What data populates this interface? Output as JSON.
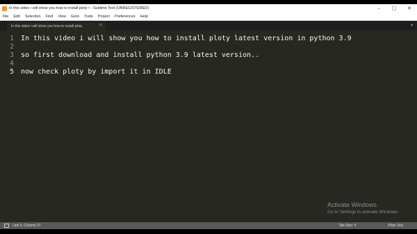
{
  "window": {
    "title": "In this video i will show you how to install ploty • - Sublime Text (UNREGISTERED)",
    "controls": [
      "–",
      "▢",
      "✕"
    ]
  },
  "menu": [
    "File",
    "Edit",
    "Selection",
    "Find",
    "View",
    "Goto",
    "Tools",
    "Project",
    "Preferences",
    "Help"
  ],
  "tab": {
    "label": "In this video i will show you how to install ploty",
    "close": "×",
    "overflow": "▾"
  },
  "editor": {
    "lines": [
      {
        "num": "1",
        "text": "In this video i will show you how to install ploty latest version in python 3.9"
      },
      {
        "num": "2",
        "text": ""
      },
      {
        "num": "3",
        "text": "so first download and install python 3.9 latest version.."
      },
      {
        "num": "4",
        "text": ""
      },
      {
        "num": "5",
        "text": "now check ploty by import it in IDLE"
      }
    ],
    "active_line": 5
  },
  "watermark": {
    "title": "Activate Windows",
    "subtitle": "Go to Settings to activate Windows."
  },
  "status": {
    "position": "Line 5, Column 37",
    "tab_size": "Tab Size: 4",
    "syntax": "Plain Text"
  },
  "colors": {
    "editor_bg": "#272822",
    "text": "#f8f8f2",
    "gutter": "#90908a",
    "statusbar": "#595a55"
  }
}
